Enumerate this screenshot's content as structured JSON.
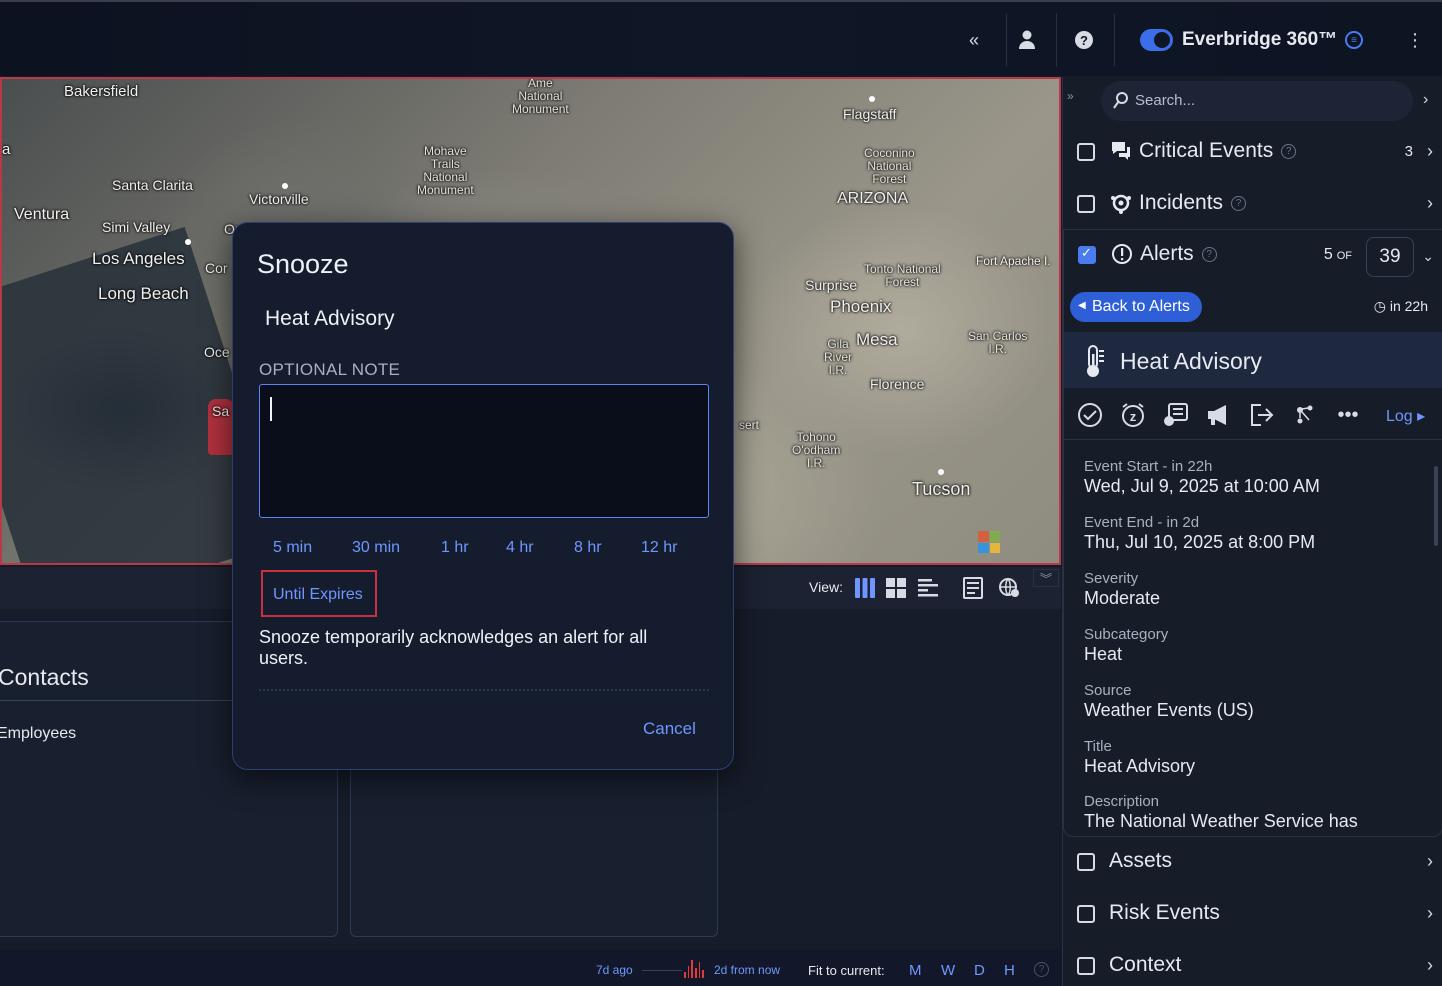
{
  "topbar": {
    "collapse_icon": "double-chevron-left-icon",
    "user_icon": "user-icon",
    "help_icon": "help-circle-icon",
    "brand": "Everbridge 360™",
    "brand_badge": "e",
    "menu_icon": "kebab-menu-icon"
  },
  "map": {
    "labels": {
      "bakersfield": "Bakersfield",
      "santa_clarita": "Santa Clarita",
      "victorville": "Victorville",
      "ventura": "Ventura",
      "simi_valley": "Simi Valley",
      "los_angeles": "Los Angeles",
      "long_beach": "Long Beach",
      "flagstaff": "Flagstaff",
      "arizona": "ARIZONA",
      "coconino": "Coconino\nNational\nForest",
      "mohave": "Mohave\nTrails\nNational\nMonument",
      "ame": "Ame\nNational\nMonument",
      "tonto": "Tonto National\nForest",
      "fort_apache": "Fort Apache I.",
      "surprise": "Surprise",
      "phoenix": "Phoenix",
      "mesa": "Mesa",
      "gila": "Gila\nRiver\nI.R.",
      "san_carlos": "San Carlos\nI.R.",
      "florence": "Florence",
      "tohono": "Tohono\nO'odham\nI.R.",
      "tucson": "Tucson",
      "sert": "sert",
      "a_left": "a",
      "oce": "Oce",
      "cor": "Cor",
      "on": "On",
      "sa": "Sa"
    }
  },
  "view_bar": {
    "label": "View:",
    "icons": [
      "columns-view-icon",
      "grid-view-icon",
      "list-view-icon",
      "report-icon",
      "globe-settings-icon"
    ],
    "collapse_icon": "double-chevron-down-icon"
  },
  "contacts": {
    "title": "Contacts",
    "item": "Employees"
  },
  "statusbar": {
    "ago": "7d ago",
    "from_now": "2d from now",
    "fit_label": "Fit to current:",
    "units": [
      "M",
      "W",
      "D",
      "H"
    ],
    "help_icon": "help-circle-icon"
  },
  "right_panel": {
    "collapse_icon": "double-chevron-right-icon",
    "search_placeholder": "Search...",
    "sections": {
      "critical_events": {
        "title": "Critical Events",
        "count": "3",
        "icon": "megaphone-chat-icon"
      },
      "incidents": {
        "title": "Incidents",
        "icon": "virus-icon"
      },
      "alerts": {
        "title": "Alerts",
        "count": "5",
        "of": "OF",
        "total": "39",
        "icon": "exclamation-circle-icon"
      },
      "assets": {
        "title": "Assets"
      },
      "risk_events": {
        "title": "Risk Events"
      },
      "context": {
        "title": "Context"
      }
    },
    "alert_detail": {
      "back_label": "Back to Alerts",
      "eta": "in 22h",
      "title": "Heat Advisory",
      "title_icon": "thermometer-icon",
      "actions": [
        "acknowledge-icon",
        "snooze-icon",
        "notes-icon",
        "megaphone-icon",
        "export-icon",
        "share-icon",
        "more-icon"
      ],
      "log_label": "Log",
      "fields": [
        {
          "label": "Event Start - in 22h",
          "value": "Wed, Jul 9, 2025 at 10:00 AM"
        },
        {
          "label": "Event End - in 2d",
          "value": "Thu, Jul 10, 2025 at 8:00 PM"
        },
        {
          "label": "Severity",
          "value": "Moderate"
        },
        {
          "label": "Subcategory",
          "value": "Heat"
        },
        {
          "label": "Source",
          "value": "Weather Events (US)"
        },
        {
          "label": "Title",
          "value": "Heat Advisory"
        },
        {
          "label": "Description",
          "value": "The National Weather Service has"
        }
      ]
    }
  },
  "modal": {
    "title": "Snooze",
    "subject": "Heat Advisory",
    "note_label": "OPTIONAL NOTE",
    "note_value": "",
    "options": [
      "5 min",
      "30 min",
      "1 hr",
      "4 hr",
      "8 hr",
      "12 hr"
    ],
    "until_expires": "Until Expires",
    "description": "Snooze temporarily acknowledges an alert for all users.",
    "cancel": "Cancel"
  }
}
